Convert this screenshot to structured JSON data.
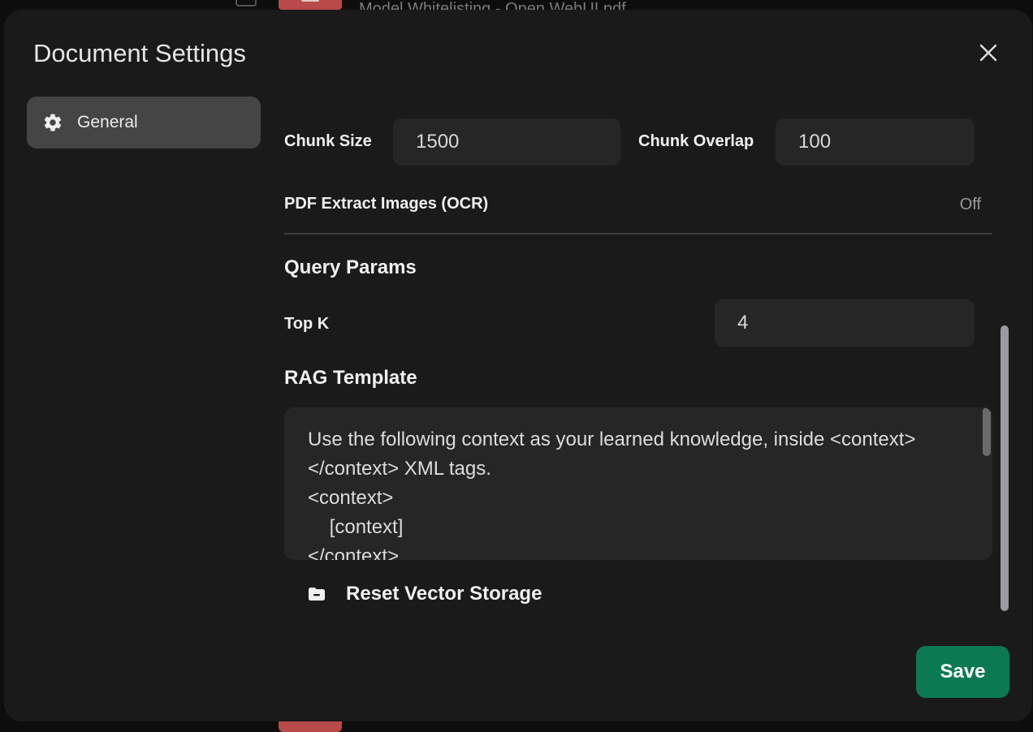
{
  "background": {
    "file_name": "Model Whitelisting - Open WebUI.pdf"
  },
  "modal": {
    "title": "Document Settings",
    "close_icon": "close-icon",
    "sidebar": {
      "items": [
        {
          "label": "General",
          "icon": "gear-icon",
          "active": true
        }
      ]
    },
    "chunk": {
      "size_label": "Chunk Size",
      "size_value": "1500",
      "overlap_label": "Chunk Overlap",
      "overlap_value": "100"
    },
    "ocr": {
      "label": "PDF Extract Images (OCR)",
      "state": "Off"
    },
    "query_params": {
      "title": "Query Params",
      "top_k_label": "Top K",
      "top_k_value": "4"
    },
    "rag": {
      "title": "RAG Template",
      "template": "Use the following context as your learned knowledge, inside <context>\n</context> XML tags.\n<context>\n    [context]\n</context>"
    },
    "reset": {
      "label": "Reset Vector Storage",
      "icon": "folder-minus-icon"
    },
    "save_label": "Save"
  },
  "colors": {
    "modal_bg": "#1a1a1a",
    "input_bg": "#262626",
    "active_item_bg": "#454545",
    "save_bg": "#0b7a52"
  }
}
